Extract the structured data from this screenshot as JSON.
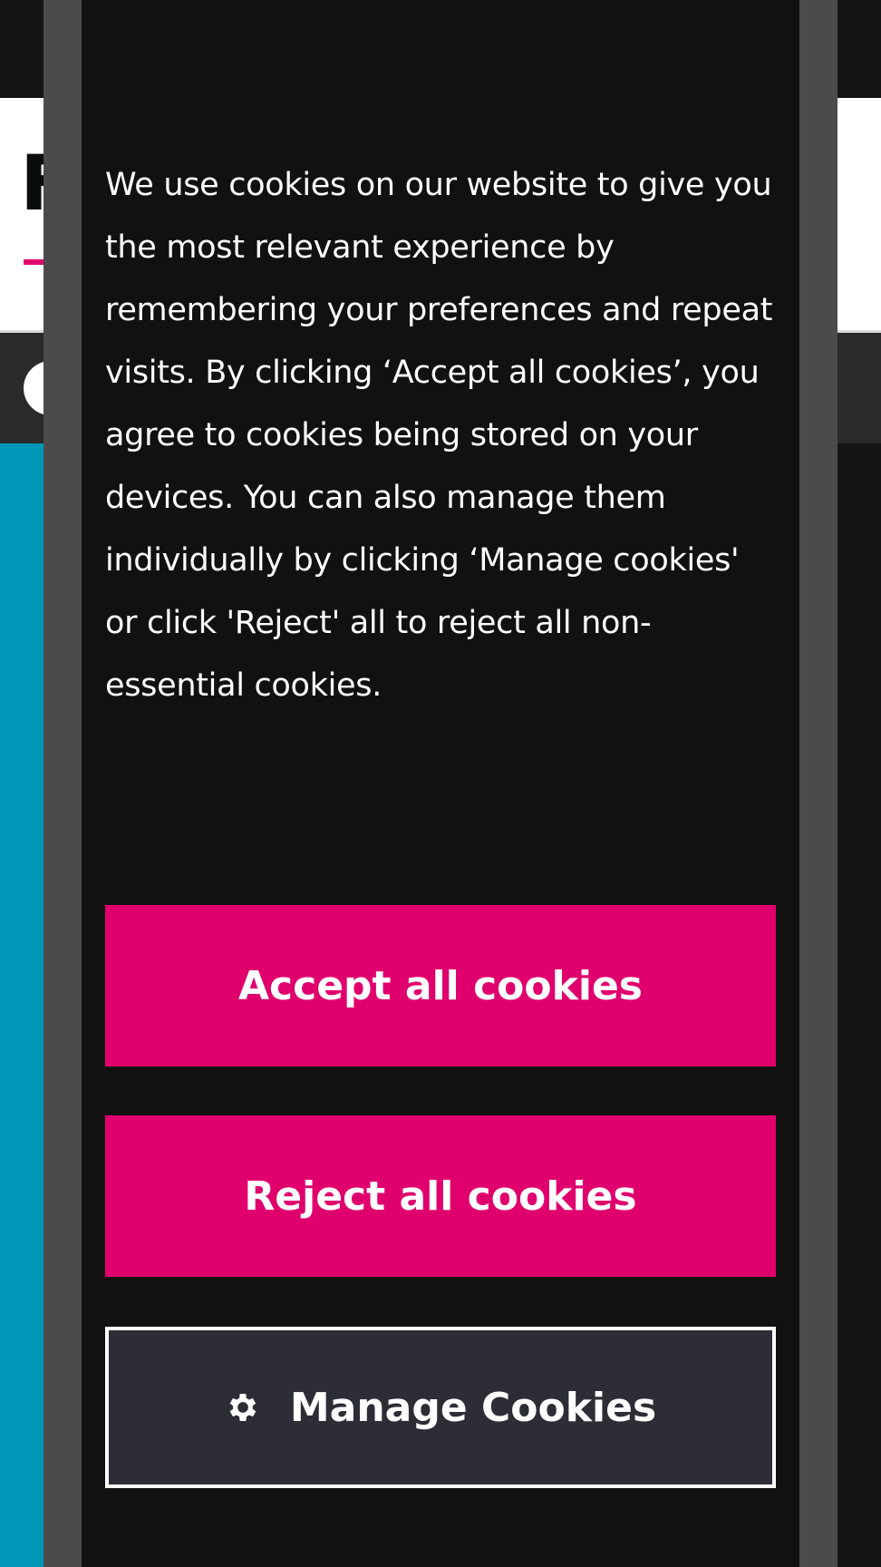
{
  "cookie_banner": {
    "message": "We use cookies on our website to give you the most relevant experience by remembering your preferences and repeat visits. By clicking ‘Accept all cookies’, you agree to cookies being stored on your devices. You can also manage them individually by clicking ‘Manage cookies' or click 'Reject' all to reject all non-essential cookies.",
    "accept_label": "Accept all cookies",
    "reject_label": "Reject all cookies",
    "manage_label": "Manage Cookies",
    "manage_icon": "gear-icon"
  },
  "background_page": {
    "logo_partial_letter": "F"
  },
  "colors": {
    "primary_button": "#e0006d",
    "manage_button": "#2d2d36",
    "modal_background": "#111111",
    "modal_border": "#4b4b4b",
    "hero_accent": "#0098b8"
  }
}
